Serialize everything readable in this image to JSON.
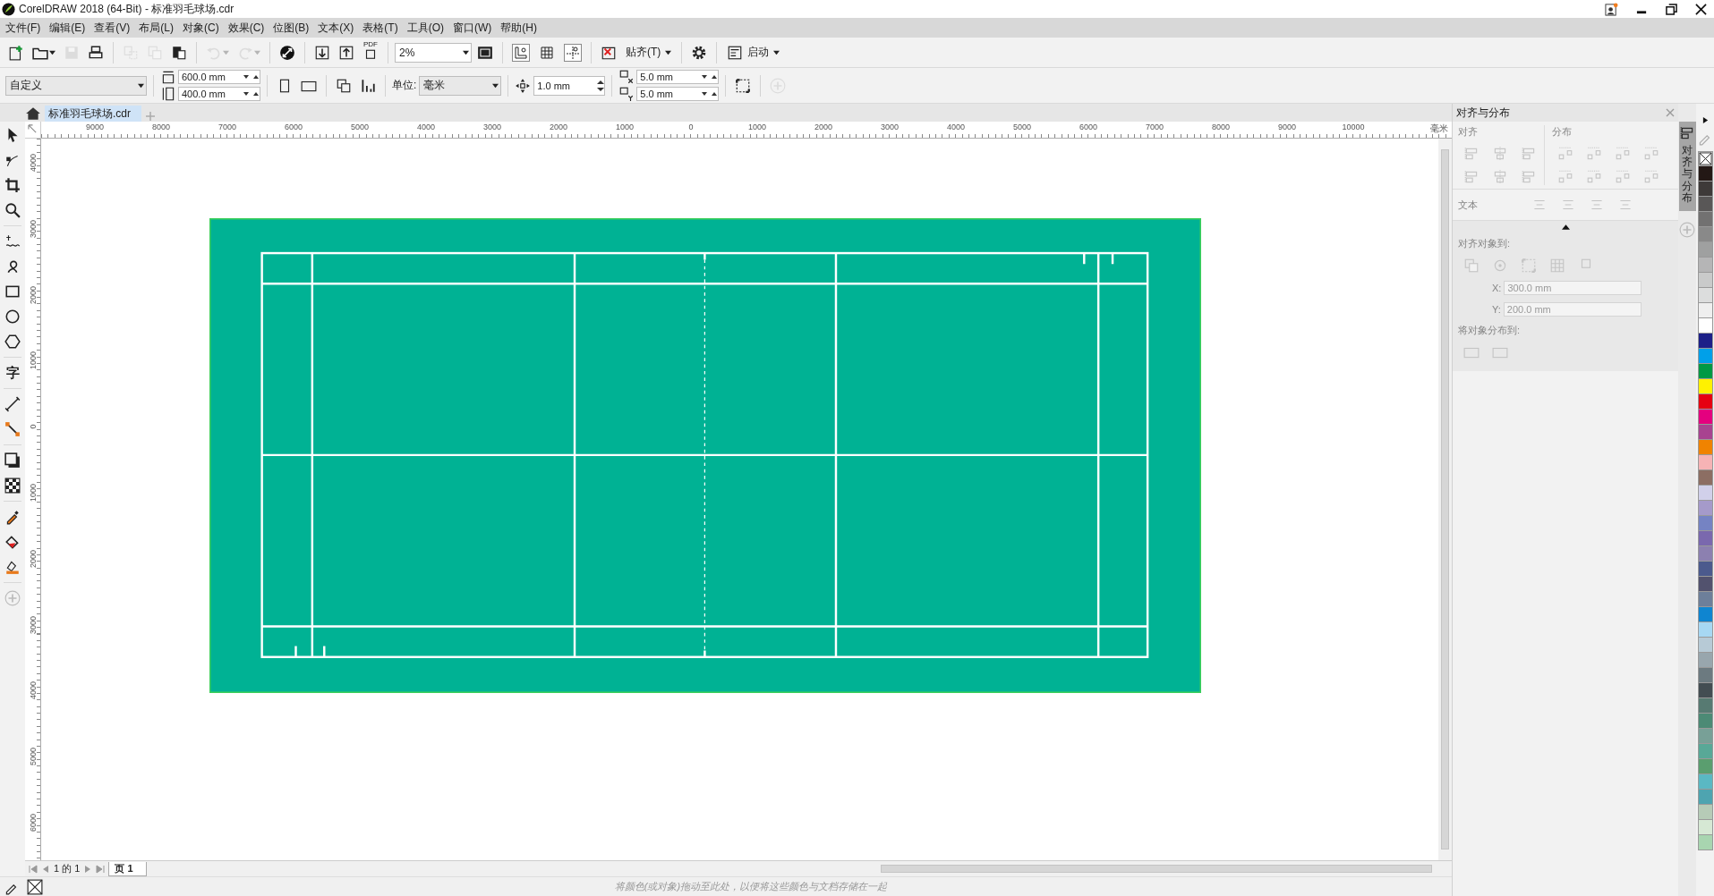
{
  "window": {
    "title": "CorelDRAW 2018 (64-Bit) - 标准羽毛球场.cdr"
  },
  "menu": [
    "文件(F)",
    "编辑(E)",
    "查看(V)",
    "布局(L)",
    "对象(C)",
    "效果(C)",
    "位图(B)",
    "文本(X)",
    "表格(T)",
    "工具(O)",
    "窗口(W)",
    "帮助(H)"
  ],
  "standard_toolbar": [
    {
      "kind": "button",
      "disabled": false
    },
    {
      "kind": "dropdown",
      "disabled": false
    },
    {
      "kind": "button",
      "disabled": true
    },
    {
      "kind": "button",
      "disabled": false
    },
    {
      "kind": "separator"
    },
    {
      "kind": "button",
      "disabled": true
    },
    {
      "kind": "button",
      "disabled": true
    },
    {
      "kind": "button",
      "disabled": false
    },
    {
      "kind": "separator"
    },
    {
      "kind": "dropdown",
      "disabled": true
    },
    {
      "kind": "dropdown",
      "disabled": true
    },
    {
      "kind": "separator"
    },
    {
      "kind": "button",
      "disabled": false
    },
    {
      "kind": "separator"
    },
    {
      "kind": "button",
      "disabled": false
    },
    {
      "kind": "button",
      "disabled": false
    },
    {
      "kind": "caption-button",
      "label": "PDF",
      "disabled": false
    },
    {
      "kind": "separator"
    },
    {
      "kind": "combo",
      "value": "2%"
    },
    {
      "kind": "button",
      "disabled": false
    },
    {
      "kind": "separator"
    },
    {
      "kind": "toggle",
      "on": true
    },
    {
      "kind": "toggle",
      "on": false
    },
    {
      "kind": "toggle",
      "on": true
    },
    {
      "kind": "separator"
    },
    {
      "kind": "button",
      "disabled": false
    },
    {
      "kind": "text-dropdown",
      "label": "贴齐(T)"
    },
    {
      "kind": "separator"
    },
    {
      "kind": "button",
      "disabled": false
    },
    {
      "kind": "separator"
    },
    {
      "kind": "text-dropdown",
      "label": "启动"
    }
  ],
  "property_bar": [
    {
      "kind": "combo",
      "value": "自定义"
    },
    {
      "kind": "separator"
    },
    {
      "kind": "spin-pair",
      "values": [
        "600.0 mm",
        "400.0 mm"
      ]
    },
    {
      "kind": "separator"
    },
    {
      "kind": "button",
      "disabled": false
    },
    {
      "kind": "button",
      "disabled": false
    },
    {
      "kind": "separator"
    },
    {
      "kind": "button",
      "disabled": false
    },
    {
      "kind": "button",
      "disabled": false
    },
    {
      "kind": "separator"
    },
    {
      "kind": "label",
      "text": "单位:"
    },
    {
      "kind": "combo",
      "value": "毫米"
    },
    {
      "kind": "separator"
    },
    {
      "kind": "spin",
      "value": "1.0 mm"
    },
    {
      "kind": "separator"
    },
    {
      "kind": "spin-pair",
      "values": [
        "5.0 mm",
        "5.0 mm"
      ]
    },
    {
      "kind": "separator"
    },
    {
      "kind": "button",
      "disabled": false
    },
    {
      "kind": "separator"
    },
    {
      "kind": "button",
      "disabled": true
    }
  ],
  "document_tabs": [
    {
      "label": "标准羽毛球场.cdr",
      "selected": true
    }
  ],
  "toolbox": {
    "text_tool": "字"
  },
  "rulers": {
    "unit": "毫米",
    "horizontal": [
      "9000",
      "8000",
      "7000",
      "6000",
      "5000",
      "4000",
      "3000",
      "2000",
      "1000",
      "0",
      "1000",
      "2000",
      "3000",
      "4000",
      "5000",
      "6000",
      "7000",
      "8000",
      "9000",
      "10000"
    ],
    "vertical": [
      "4000",
      "3000",
      "2000",
      "1000",
      "0",
      "1000",
      "2000",
      "3000",
      "4000",
      "5000",
      "6000"
    ]
  },
  "docker": {
    "title": "对齐与分布",
    "tab_label": "对齐与分布",
    "disabled": true,
    "align_label": "对齐",
    "distribute_label": "分布",
    "text_label": "文本",
    "align_to_label": "对齐对象到:",
    "x_label": "X:",
    "x_value": "300.0 mm",
    "y_label": "Y:",
    "y_value": "200.0 mm",
    "distribute_to_label": "将对象分布到:"
  },
  "page_navigator": {
    "position": "1 的 1",
    "pages": [
      {
        "label": "页 1",
        "selected": true
      }
    ]
  },
  "status_bar": {
    "hint": "将颜色(或对象)拖动至此处，以便将这些颜色与文档存储在一起"
  },
  "palette": [
    {
      "kind": "none"
    },
    {
      "kind": "swatch",
      "color": "#231815"
    },
    {
      "kind": "swatch",
      "color": "#3e3a39"
    },
    {
      "kind": "swatch",
      "color": "#595757"
    },
    {
      "kind": "swatch",
      "color": "#727171"
    },
    {
      "kind": "swatch",
      "color": "#898989"
    },
    {
      "kind": "swatch",
      "color": "#9fa0a0"
    },
    {
      "kind": "swatch",
      "color": "#b5b5b6"
    },
    {
      "kind": "swatch",
      "color": "#c9caca"
    },
    {
      "kind": "swatch",
      "color": "#dcdddd"
    },
    {
      "kind": "swatch",
      "color": "#efefef"
    },
    {
      "kind": "swatch",
      "color": "#ffffff"
    },
    {
      "kind": "swatch",
      "color": "#1d2088"
    },
    {
      "kind": "swatch",
      "color": "#00a0e9"
    },
    {
      "kind": "swatch",
      "color": "#009944"
    },
    {
      "kind": "swatch",
      "color": "#fff100"
    },
    {
      "kind": "swatch",
      "color": "#e60012"
    },
    {
      "kind": "swatch",
      "color": "#e4007f"
    },
    {
      "kind": "swatch",
      "color": "#a84390"
    },
    {
      "kind": "swatch",
      "color": "#f08300"
    },
    {
      "kind": "swatch",
      "color": "#f6b3b5"
    },
    {
      "kind": "swatch",
      "color": "#8c6e63"
    },
    {
      "kind": "swatch",
      "color": "#d1d0ea"
    },
    {
      "kind": "swatch",
      "color": "#a59aca"
    },
    {
      "kind": "swatch",
      "color": "#7583c3"
    },
    {
      "kind": "swatch",
      "color": "#7a68ae"
    },
    {
      "kind": "swatch",
      "color": "#8c80b0"
    },
    {
      "kind": "swatch",
      "color": "#4b5a8d"
    },
    {
      "kind": "swatch",
      "color": "#52526e"
    },
    {
      "kind": "swatch",
      "color": "#6d7f9a"
    },
    {
      "kind": "swatch",
      "color": "#0f85d0"
    },
    {
      "kind": "swatch",
      "color": "#a7d8f3"
    },
    {
      "kind": "swatch",
      "color": "#b7cad6"
    },
    {
      "kind": "swatch",
      "color": "#98a6ad"
    },
    {
      "kind": "swatch",
      "color": "#6c7a80"
    },
    {
      "kind": "swatch",
      "color": "#434d52"
    },
    {
      "kind": "swatch",
      "color": "#577a72"
    },
    {
      "kind": "swatch",
      "color": "#4c8a75"
    },
    {
      "kind": "swatch",
      "color": "#78a097"
    },
    {
      "kind": "swatch",
      "color": "#58a897"
    },
    {
      "kind": "swatch",
      "color": "#5a9e6f"
    },
    {
      "kind": "swatch",
      "color": "#5ab8c3"
    },
    {
      "kind": "swatch",
      "color": "#4ea4b0"
    },
    {
      "kind": "swatch",
      "color": "#b6cbb7"
    },
    {
      "kind": "swatch",
      "color": "#d6e8d4"
    },
    {
      "kind": "swatch",
      "color": "#a8d5b0"
    }
  ]
}
